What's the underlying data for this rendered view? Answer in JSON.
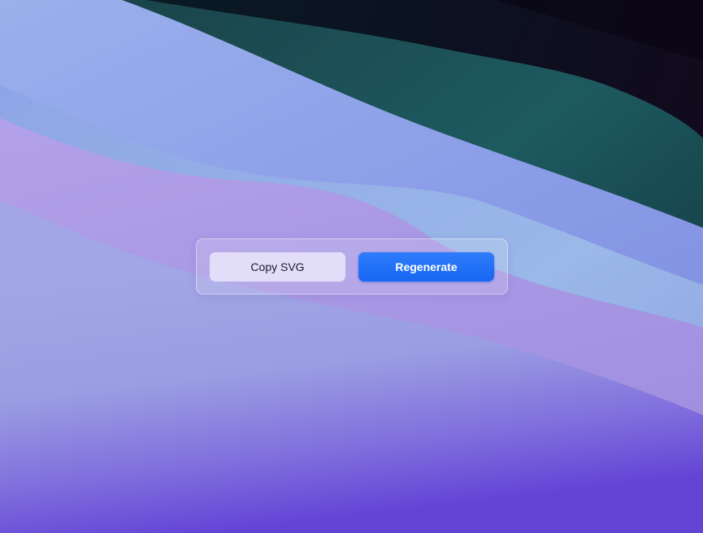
{
  "toolbar": {
    "copy_label": "Copy SVG",
    "regenerate_label": "Regenerate"
  },
  "colors": {
    "primary": "#1866f2",
    "secondary_bg": "#e8e4fa",
    "wave_dark": "#0b1424",
    "wave_teal": "#1d5a60",
    "wave_periwinkle": "#93a6e6",
    "wave_violet": "#ad9fe6",
    "wave_bottom": "#6a48d8"
  }
}
